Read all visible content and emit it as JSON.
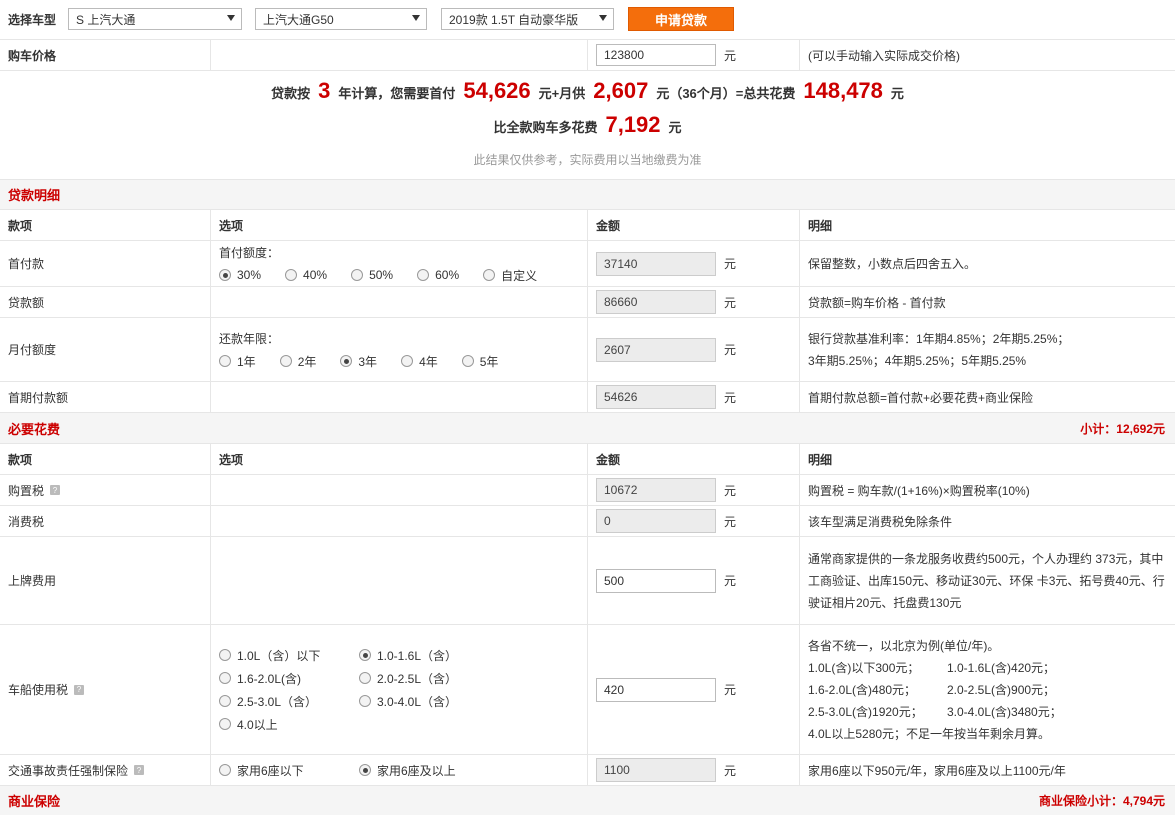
{
  "top": {
    "label": "选择车型",
    "brand": "S 上汽大通",
    "model": "上汽大通G50",
    "version": "2019款 1.5T 自动豪华版",
    "apply_button": "申请贷款"
  },
  "price": {
    "label": "购车价格",
    "value": "123800",
    "unit": "元",
    "hint": "(可以手动输入实际成交价格)"
  },
  "summary": {
    "prefix": "贷款按",
    "years": "3",
    "text1": "年计算，您需要首付",
    "down_payment": "54,626",
    "text2": "元+月供",
    "monthly": "2,607",
    "text3": "元（36个月）=总共花费",
    "total": "148,478",
    "unit": "元",
    "extra_label": "比全款购车多花费",
    "extra": "7,192",
    "extra_unit": "元",
    "note": "此结果仅供参考，实际费用以当地缴费为准"
  },
  "loan": {
    "title": "贷款明细",
    "headers": [
      "款项",
      "选项",
      "金额",
      "明细"
    ],
    "down": {
      "label": "首付款",
      "option_label": "首付额度：",
      "options": [
        "30%",
        "40%",
        "50%",
        "60%",
        "自定义"
      ],
      "selected": 0,
      "amount": "37140",
      "detail": "保留整数，小数点后四舍五入。"
    },
    "loan_amount": {
      "label": "贷款额",
      "amount": "86660",
      "detail": "贷款额=购车价格 - 首付款"
    },
    "monthly": {
      "label": "月付额度",
      "option_label": "还款年限：",
      "options": [
        "1年",
        "2年",
        "3年",
        "4年",
        "5年"
      ],
      "selected": 2,
      "amount": "2607",
      "detail_line1": "银行贷款基准利率：1年期4.85%；2年期5.25%；",
      "detail_line2": "3年期5.25%；4年期5.25%；5年期5.25%"
    },
    "first": {
      "label": "首期付款额",
      "amount": "54626",
      "detail": "首期付款总额=首付款+必要花费+商业保险"
    },
    "unit": "元"
  },
  "necessary": {
    "title": "必要花费",
    "subtotal": "小计：12,692元",
    "headers": [
      "款项",
      "选项",
      "金额",
      "明细"
    ],
    "purchase_tax": {
      "label": "购置税",
      "amount": "10672",
      "detail": "购置税 = 购车款/(1+16%)×购置税率(10%)"
    },
    "consumption_tax": {
      "label": "消费税",
      "amount": "0",
      "detail": "该车型满足消费税免除条件"
    },
    "plate": {
      "label": "上牌费用",
      "amount": "500",
      "detail_line1": "通常商家提供的一条龙服务收费约500元，个人办理约 373元，其中",
      "detail_line2": "工商验证、出库150元、移动证30元、环保 卡3元、拓号费40元、行",
      "detail_line3": "驶证相片20元、托盘费130元"
    },
    "vehicle_tax": {
      "label": "车船使用税",
      "options": [
        "1.0L（含）以下",
        "1.0-1.6L（含）",
        "1.6-2.0L(含)",
        "2.0-2.5L（含）",
        "2.5-3.0L（含）",
        "3.0-4.0L（含）",
        "4.0以上"
      ],
      "selected": 1,
      "amount": "420",
      "detail_line1": "各省不统一，以北京为例(单位/年)。",
      "detail_rows": [
        [
          "1.0L(含)以下300元；",
          "1.0-1.6L(含)420元；"
        ],
        [
          "1.6-2.0L(含)480元；",
          "2.0-2.5L(含)900元；"
        ],
        [
          "2.5-3.0L(含)1920元；",
          "3.0-4.0L(含)3480元；"
        ]
      ],
      "detail_last": "4.0L以上5280元；不足一年按当年剩余月算。"
    },
    "insurance": {
      "label": "交通事故责任强制保险",
      "options": [
        "家用6座以下",
        "家用6座及以上"
      ],
      "selected": 1,
      "amount": "1100",
      "detail": "家用6座以下950元/年，家用6座及以上1100元/年"
    },
    "unit": "元"
  },
  "commercial": {
    "title": "商业保险",
    "subtotal": "商业保险小计：4,794元"
  }
}
